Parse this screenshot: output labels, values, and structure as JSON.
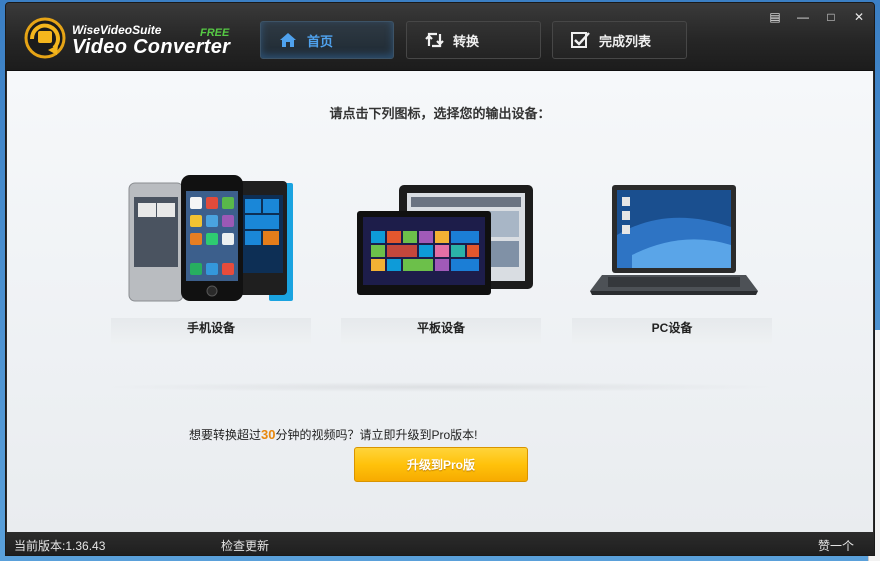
{
  "app": {
    "brand_top": "WiseVideoSuite",
    "brand_free": "FREE",
    "brand_main": "Video Converter"
  },
  "nav": {
    "tabs": [
      {
        "label": "首页",
        "icon": "home-icon",
        "active": true
      },
      {
        "label": "转换",
        "icon": "convert-icon",
        "active": false
      },
      {
        "label": "完成列表",
        "icon": "checklist-icon",
        "active": false
      }
    ]
  },
  "window_controls": {
    "skin": "▤",
    "minimize": "—",
    "maximize": "□",
    "close": "✕"
  },
  "main": {
    "prompt": "请点击下列图标，选择您的输出设备：",
    "devices": [
      {
        "label": "手机设备",
        "icon": "phones-icon"
      },
      {
        "label": "平板设备",
        "icon": "tablets-icon"
      },
      {
        "label": "PC设备",
        "icon": "laptop-icon"
      }
    ],
    "upsell_before": "想要转换超过",
    "upsell_num": "30",
    "upsell_after": "分钟的视频吗？请立即升级到Pro版本!",
    "upgrade_button": "升级到Pro版"
  },
  "status": {
    "version": "当前版本:1.36.43",
    "check_update": "检查更新",
    "like": "赞一个"
  },
  "colors": {
    "accent_blue": "#4fa2ee",
    "free_green": "#56c944",
    "upsell_orange": "#e8870c",
    "button_yellow": "#ffc20b"
  }
}
